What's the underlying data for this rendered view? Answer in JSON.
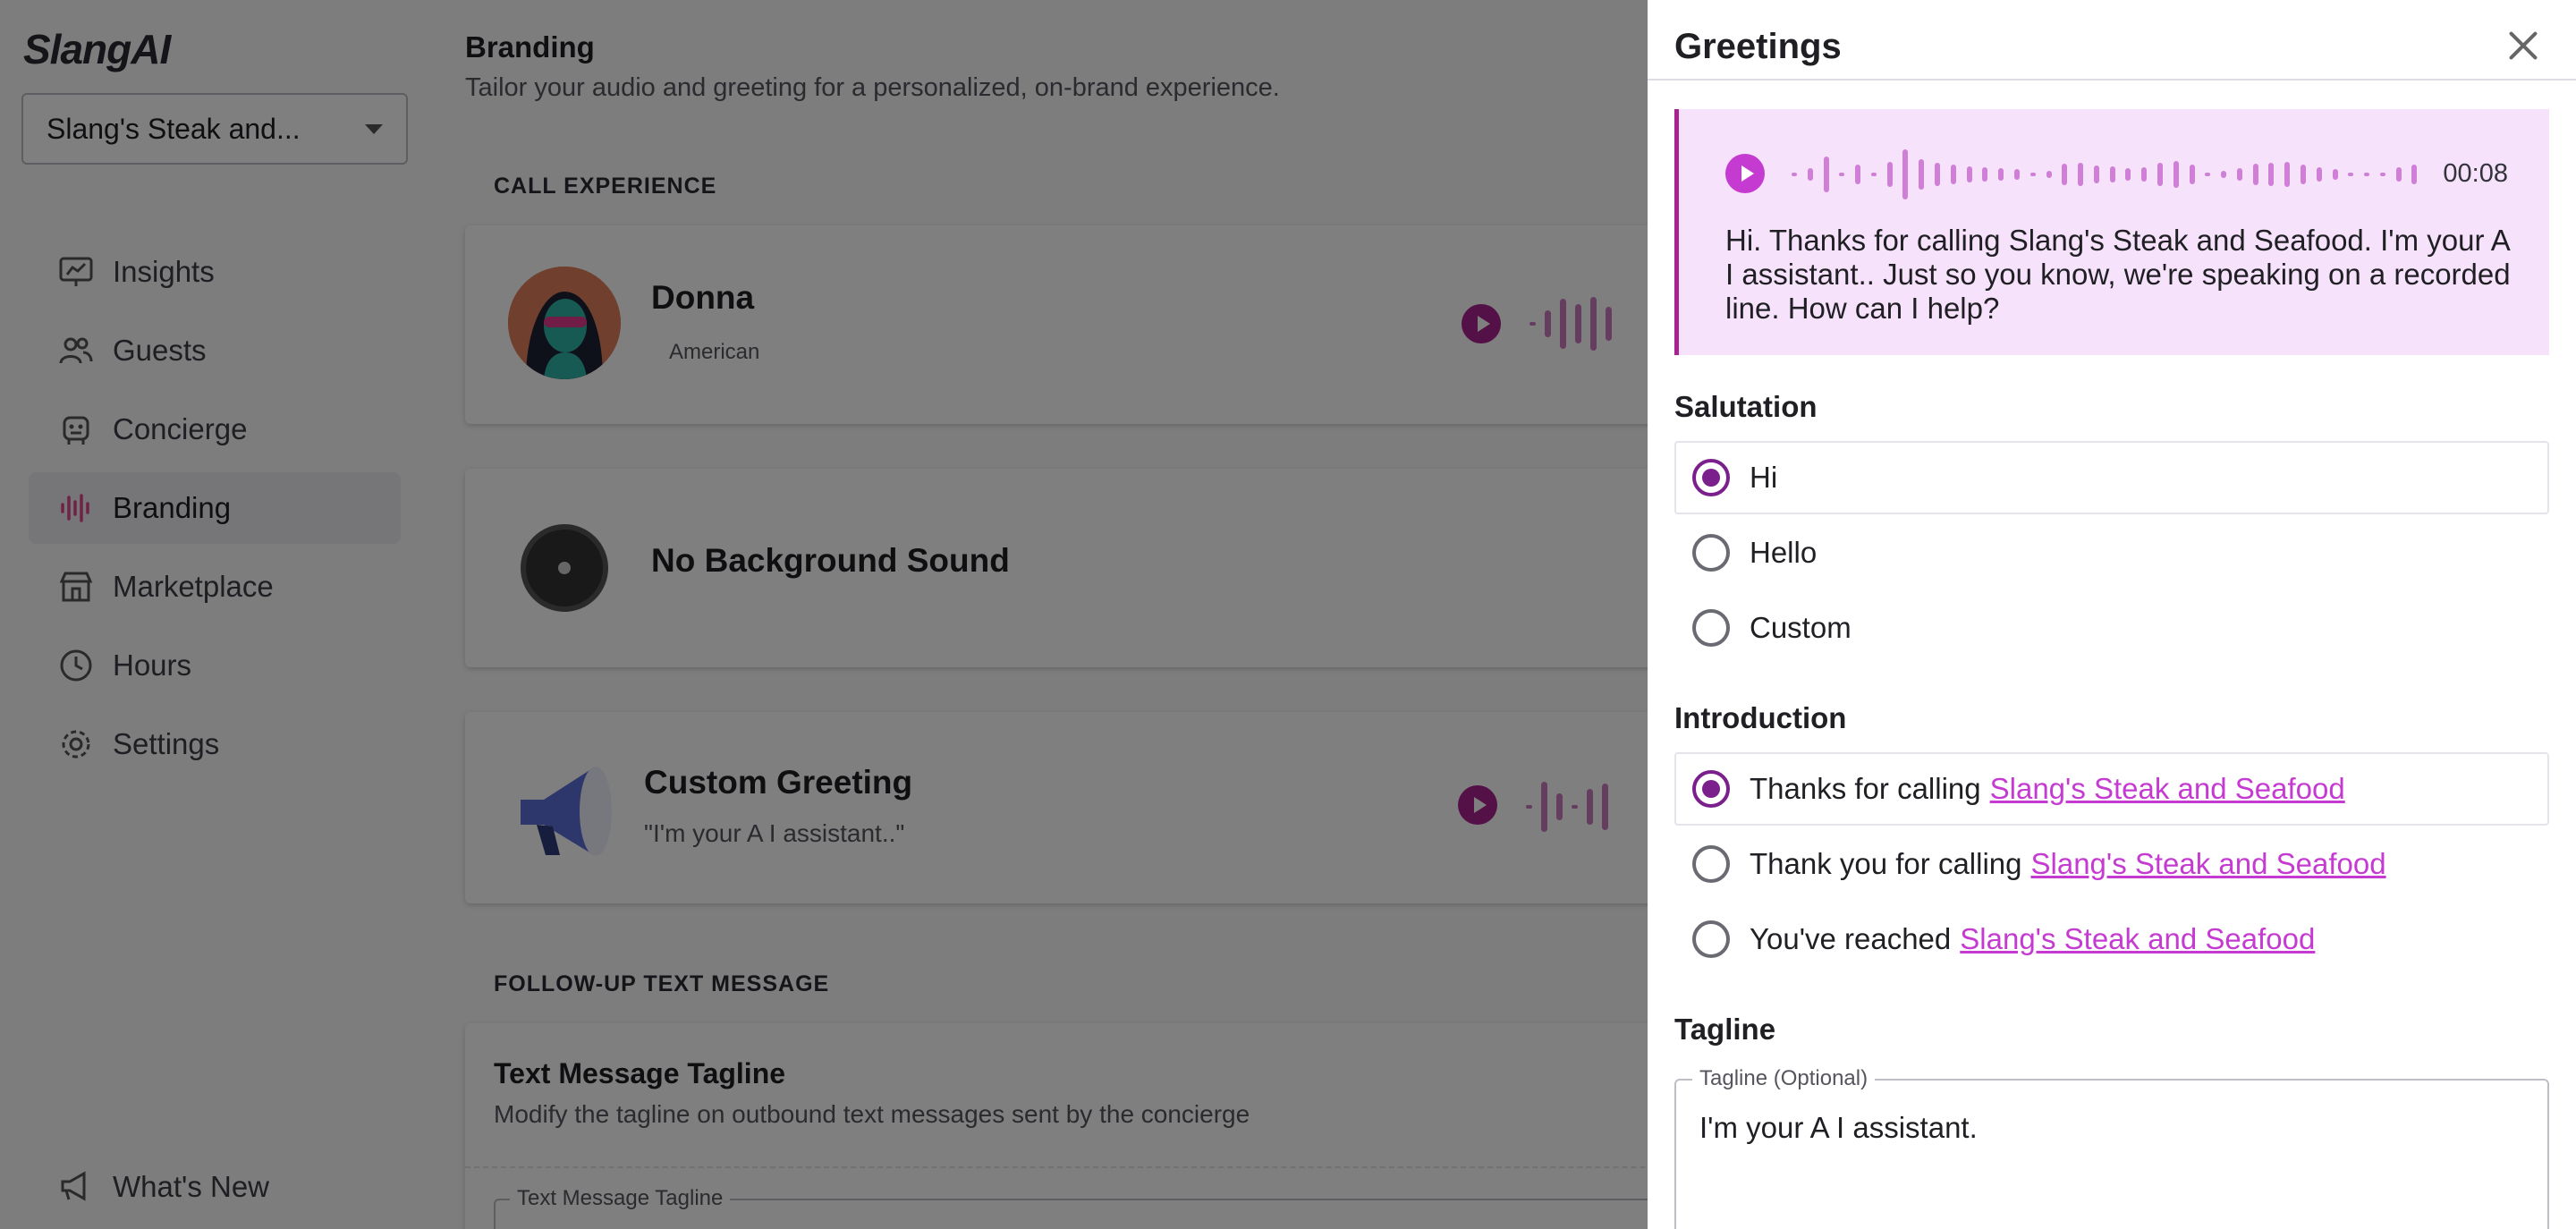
{
  "sidebar": {
    "logo": "SlangAI",
    "account": "Slang's Steak and...",
    "items": [
      {
        "label": "Insights",
        "icon": "insights-icon",
        "active": false
      },
      {
        "label": "Guests",
        "icon": "guests-icon",
        "active": false
      },
      {
        "label": "Concierge",
        "icon": "concierge-icon",
        "active": false
      },
      {
        "label": "Branding",
        "icon": "branding-icon",
        "active": true
      },
      {
        "label": "Marketplace",
        "icon": "marketplace-icon",
        "active": false
      },
      {
        "label": "Hours",
        "icon": "clock-icon",
        "active": false
      },
      {
        "label": "Settings",
        "icon": "gear-icon",
        "active": false
      }
    ],
    "whats_new": "What's New"
  },
  "main": {
    "title": "Branding",
    "subtitle": "Tailor your audio and greeting for a personalized, on-brand experience.",
    "call_experience_label": "CALL EXPERIENCE",
    "voice_card": {
      "name": "Donna",
      "accent": "American"
    },
    "background_card": {
      "title": "No Background Sound"
    },
    "greeting_card": {
      "title": "Custom Greeting",
      "quote": "\"I'm your A I assistant..\""
    },
    "followup_label": "FOLLOW-UP TEXT MESSAGE",
    "tagline_card": {
      "title": "Text Message Tagline",
      "description": "Modify the tagline on outbound text messages sent by the concierge",
      "field_legend": "Text Message Tagline"
    }
  },
  "drawer": {
    "title": "Greetings",
    "preview": {
      "duration": "00:08",
      "script": "Hi. Thanks for calling Slang's Steak and Seafood. I'm your A I assistant.. Just so you know, we're speaking on a recorded line. How can I help?"
    },
    "salutation": {
      "title": "Salutation",
      "options": [
        {
          "label": "Hi",
          "selected": true
        },
        {
          "label": "Hello",
          "selected": false
        },
        {
          "label": "Custom",
          "selected": false
        }
      ]
    },
    "introduction": {
      "title": "Introduction",
      "options": [
        {
          "label": "Thanks for calling",
          "link": "Slang's Steak and Seafood",
          "selected": true
        },
        {
          "label": "Thank you for calling",
          "link": "Slang's Steak and Seafood",
          "selected": false
        },
        {
          "label": "You've reached",
          "link": "Slang's Steak and Seafood",
          "selected": false
        }
      ]
    },
    "tagline": {
      "title": "Tagline",
      "legend": "Tagline (Optional)",
      "value": "I'm your A I assistant."
    }
  },
  "colors": {
    "accent": "#a8238f",
    "accent_light": "#c53bd2",
    "preview_bg": "#f7e2fb",
    "overlay": "rgba(0,0,0,0.5)"
  }
}
